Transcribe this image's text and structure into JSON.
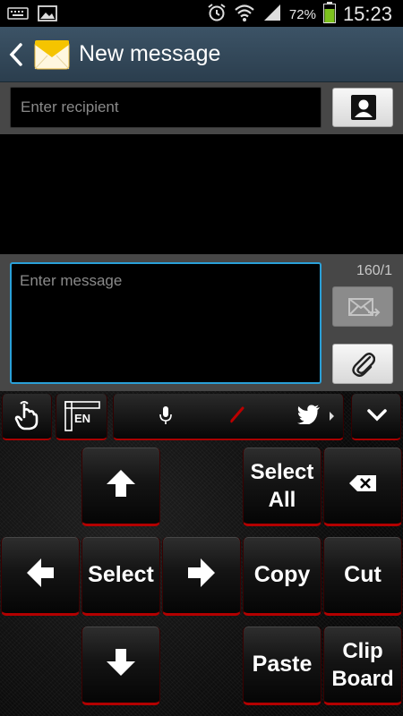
{
  "status_bar": {
    "battery_percent": "72%",
    "time": "15:23"
  },
  "action_bar": {
    "title": "New message"
  },
  "recipient": {
    "placeholder": "Enter recipient"
  },
  "compose": {
    "placeholder": "Enter message",
    "char_counter": "160/1"
  },
  "keyboard": {
    "toolbar": {
      "language": "EN"
    },
    "keys": {
      "select_all": "Select All",
      "select": "Select",
      "copy": "Copy",
      "cut": "Cut",
      "paste": "Paste",
      "clipboard": "Clip Board"
    }
  },
  "colors": {
    "action_bar": "#34495a",
    "focus_border": "#2aa0d8",
    "key_accent": "#b30000",
    "battery": "#7dc21e"
  }
}
